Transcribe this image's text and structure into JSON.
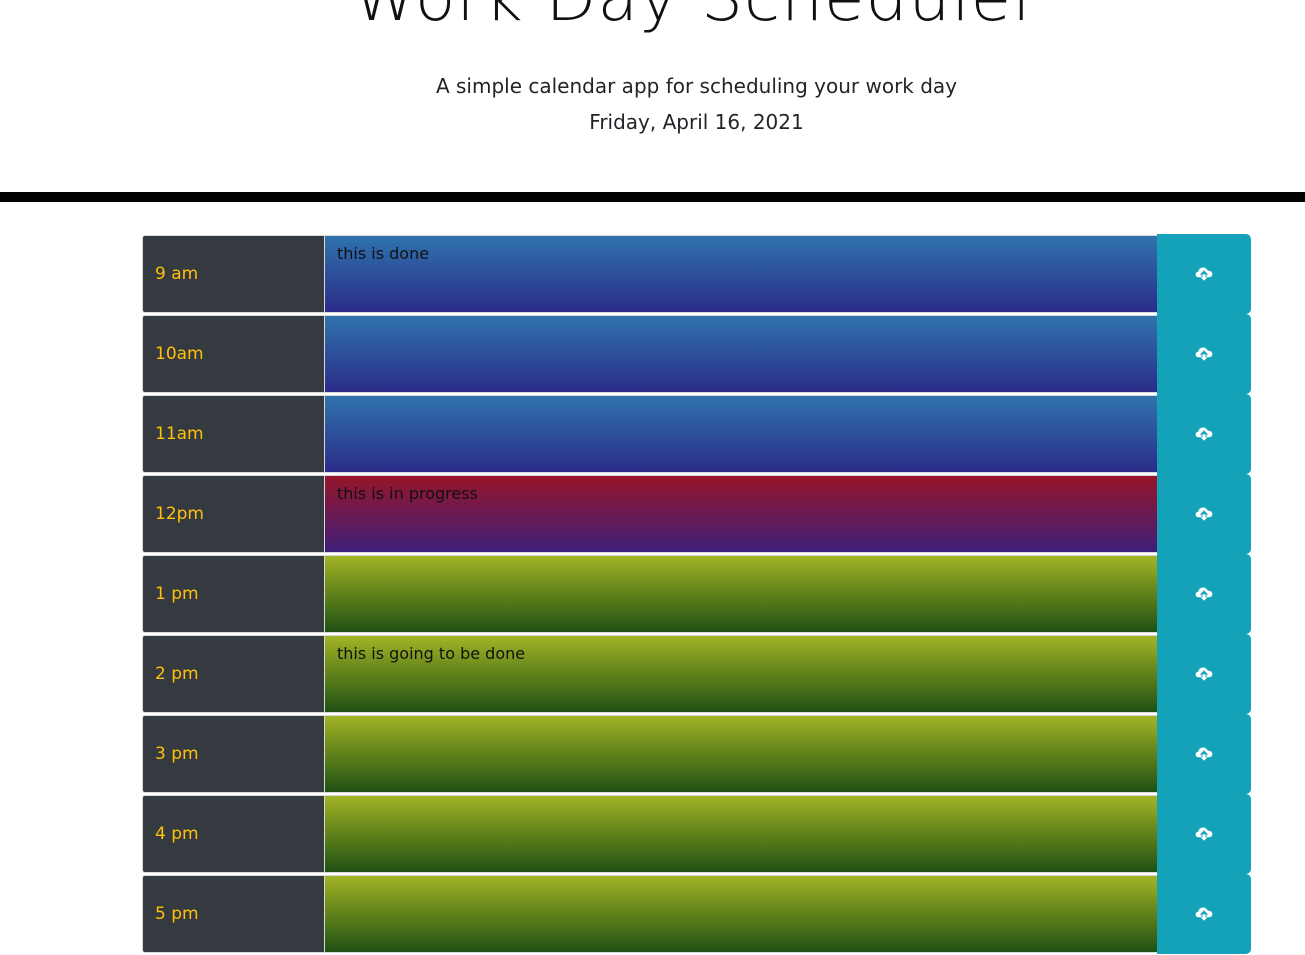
{
  "header": {
    "title": "Work Day Scheduler",
    "lead": "A simple calendar app for scheduling your work day",
    "current_day": "Friday, April 16, 2021"
  },
  "icons": {
    "save": "cloud-upload-icon"
  },
  "colors": {
    "top_accent": "#2d1fa3",
    "hour_bg": "#343a40",
    "hour_text": "#ffc107",
    "save_button": "#14a2b8",
    "past_top": "#2f73ad",
    "past_bottom": "#2a2c88",
    "present_top": "#97152a",
    "present_bottom": "#3e1f7a",
    "future_top": "#a2b324",
    "future_bottom": "#1f5113"
  },
  "time_blocks": [
    {
      "hour": "9 am",
      "text": "this is done",
      "status": "past"
    },
    {
      "hour": "10am",
      "text": "",
      "status": "past"
    },
    {
      "hour": "11am",
      "text": "",
      "status": "past"
    },
    {
      "hour": "12pm",
      "text": "this is in progress",
      "status": "present"
    },
    {
      "hour": "1 pm",
      "text": "",
      "status": "future"
    },
    {
      "hour": "2 pm",
      "text": "this is going to be done",
      "status": "future"
    },
    {
      "hour": "3 pm",
      "text": "",
      "status": "future"
    },
    {
      "hour": "4 pm",
      "text": "",
      "status": "future"
    },
    {
      "hour": "5 pm",
      "text": "",
      "status": "future"
    }
  ]
}
